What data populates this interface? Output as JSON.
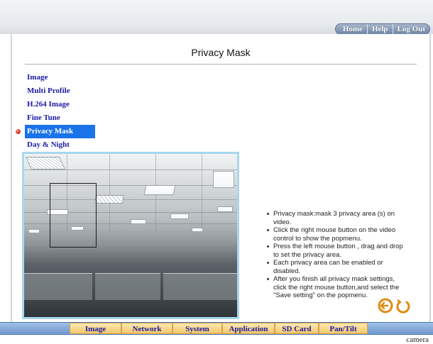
{
  "header": {
    "links": [
      "Home",
      "Help",
      "Log Out"
    ]
  },
  "page": {
    "title": "Privacy Mask"
  },
  "submenu": {
    "items": [
      {
        "label": "Image",
        "active": false
      },
      {
        "label": "Multi Profile",
        "active": false
      },
      {
        "label": "H.264 Image",
        "active": false
      },
      {
        "label": "Fine Tune",
        "active": false
      },
      {
        "label": "Privacy Mask",
        "active": true
      },
      {
        "label": "Day & Night",
        "active": false
      }
    ]
  },
  "instructions": [
    "Privacy mask:mask 3 privacy area (s) on video.",
    "Click the right mouse button on the video control to show the popmenu.",
    "Press the left mouse button , drag and drop to set the privacy area.",
    "Each privacy area can be enabled or disabled.",
    "After you finish all privacy mask settings, click the right mouse button,and select the \"Save setting\" on the popmenu."
  ],
  "nav_icons": [
    "back-arrow-icon",
    "refresh-icon"
  ],
  "bottom_nav": {
    "tabs": [
      "Image",
      "Network",
      "System",
      "Application",
      "SD Card",
      "Pan/Tilt"
    ]
  },
  "footer": {
    "label": "camera"
  },
  "colors": {
    "accent": "#1a73e8",
    "link": "#1a1aa6",
    "tab_bg": "#f4c76c",
    "bar": "#6f98cf",
    "icon_orange": "#e08a12"
  }
}
